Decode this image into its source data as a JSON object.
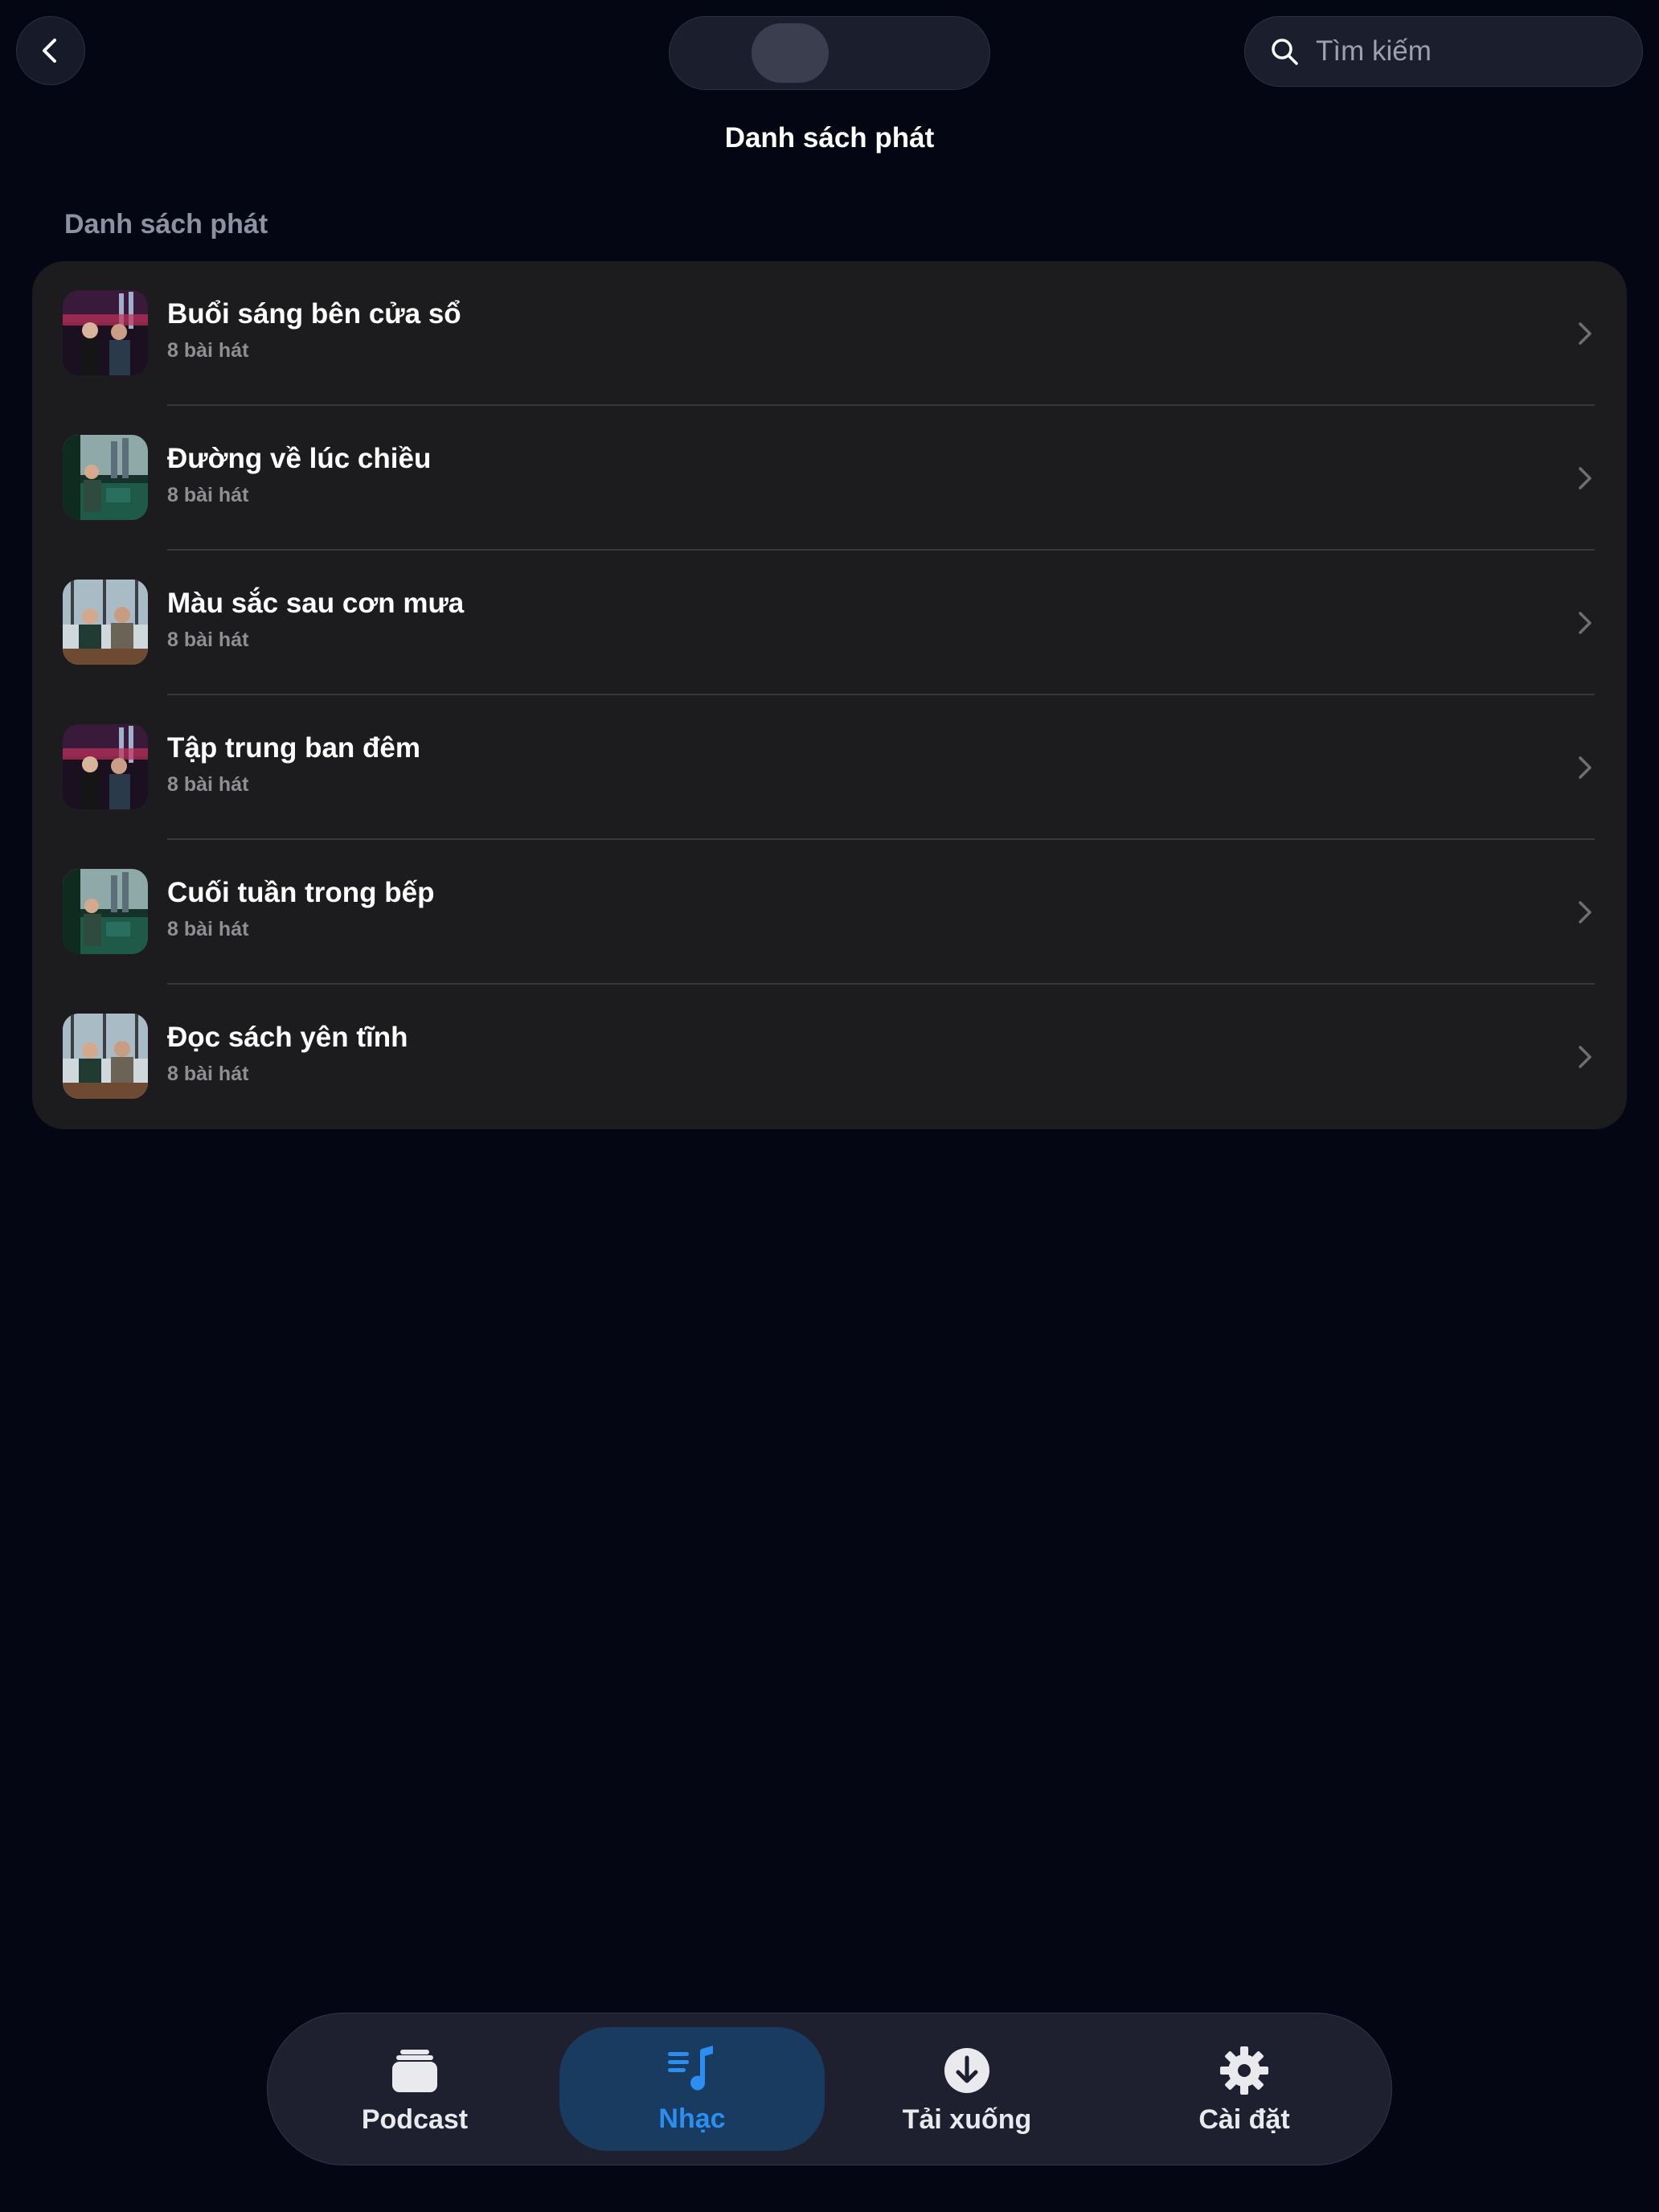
{
  "header": {
    "back_icon": "chevron-left-icon",
    "search": {
      "icon": "search-icon",
      "placeholder": "Tìm kiếm",
      "value": ""
    },
    "title": "Danh sách phát"
  },
  "section": {
    "title": "Danh sách phát"
  },
  "playlists": [
    {
      "title": "Buổi sáng bên cửa sổ",
      "subtitle": "8 bài hát"
    },
    {
      "title": "Đường về lúc chiều",
      "subtitle": "8 bài hát"
    },
    {
      "title": "Màu sắc sau cơn mưa",
      "subtitle": "8 bài hát"
    },
    {
      "title": "Tập trung ban đêm",
      "subtitle": "8 bài hát"
    },
    {
      "title": "Cuối tuần trong bếp",
      "subtitle": "8 bài hát"
    },
    {
      "title": "Đọc sách yên tĩnh",
      "subtitle": "8 bài hát"
    }
  ],
  "tabs": [
    {
      "label": "Podcast",
      "icon": "podcast-stack-icon",
      "active": false
    },
    {
      "label": "Nhạc",
      "icon": "music-list-icon",
      "active": true
    },
    {
      "label": "Tải xuống",
      "icon": "download-icon",
      "active": false
    },
    {
      "label": "Cài đặt",
      "icon": "gear-icon",
      "active": false
    }
  ],
  "colors": {
    "background": "#040614",
    "card": "#1c1c1e",
    "accent": "#2b8ef0",
    "active_tab_bg": "#193b5f"
  }
}
